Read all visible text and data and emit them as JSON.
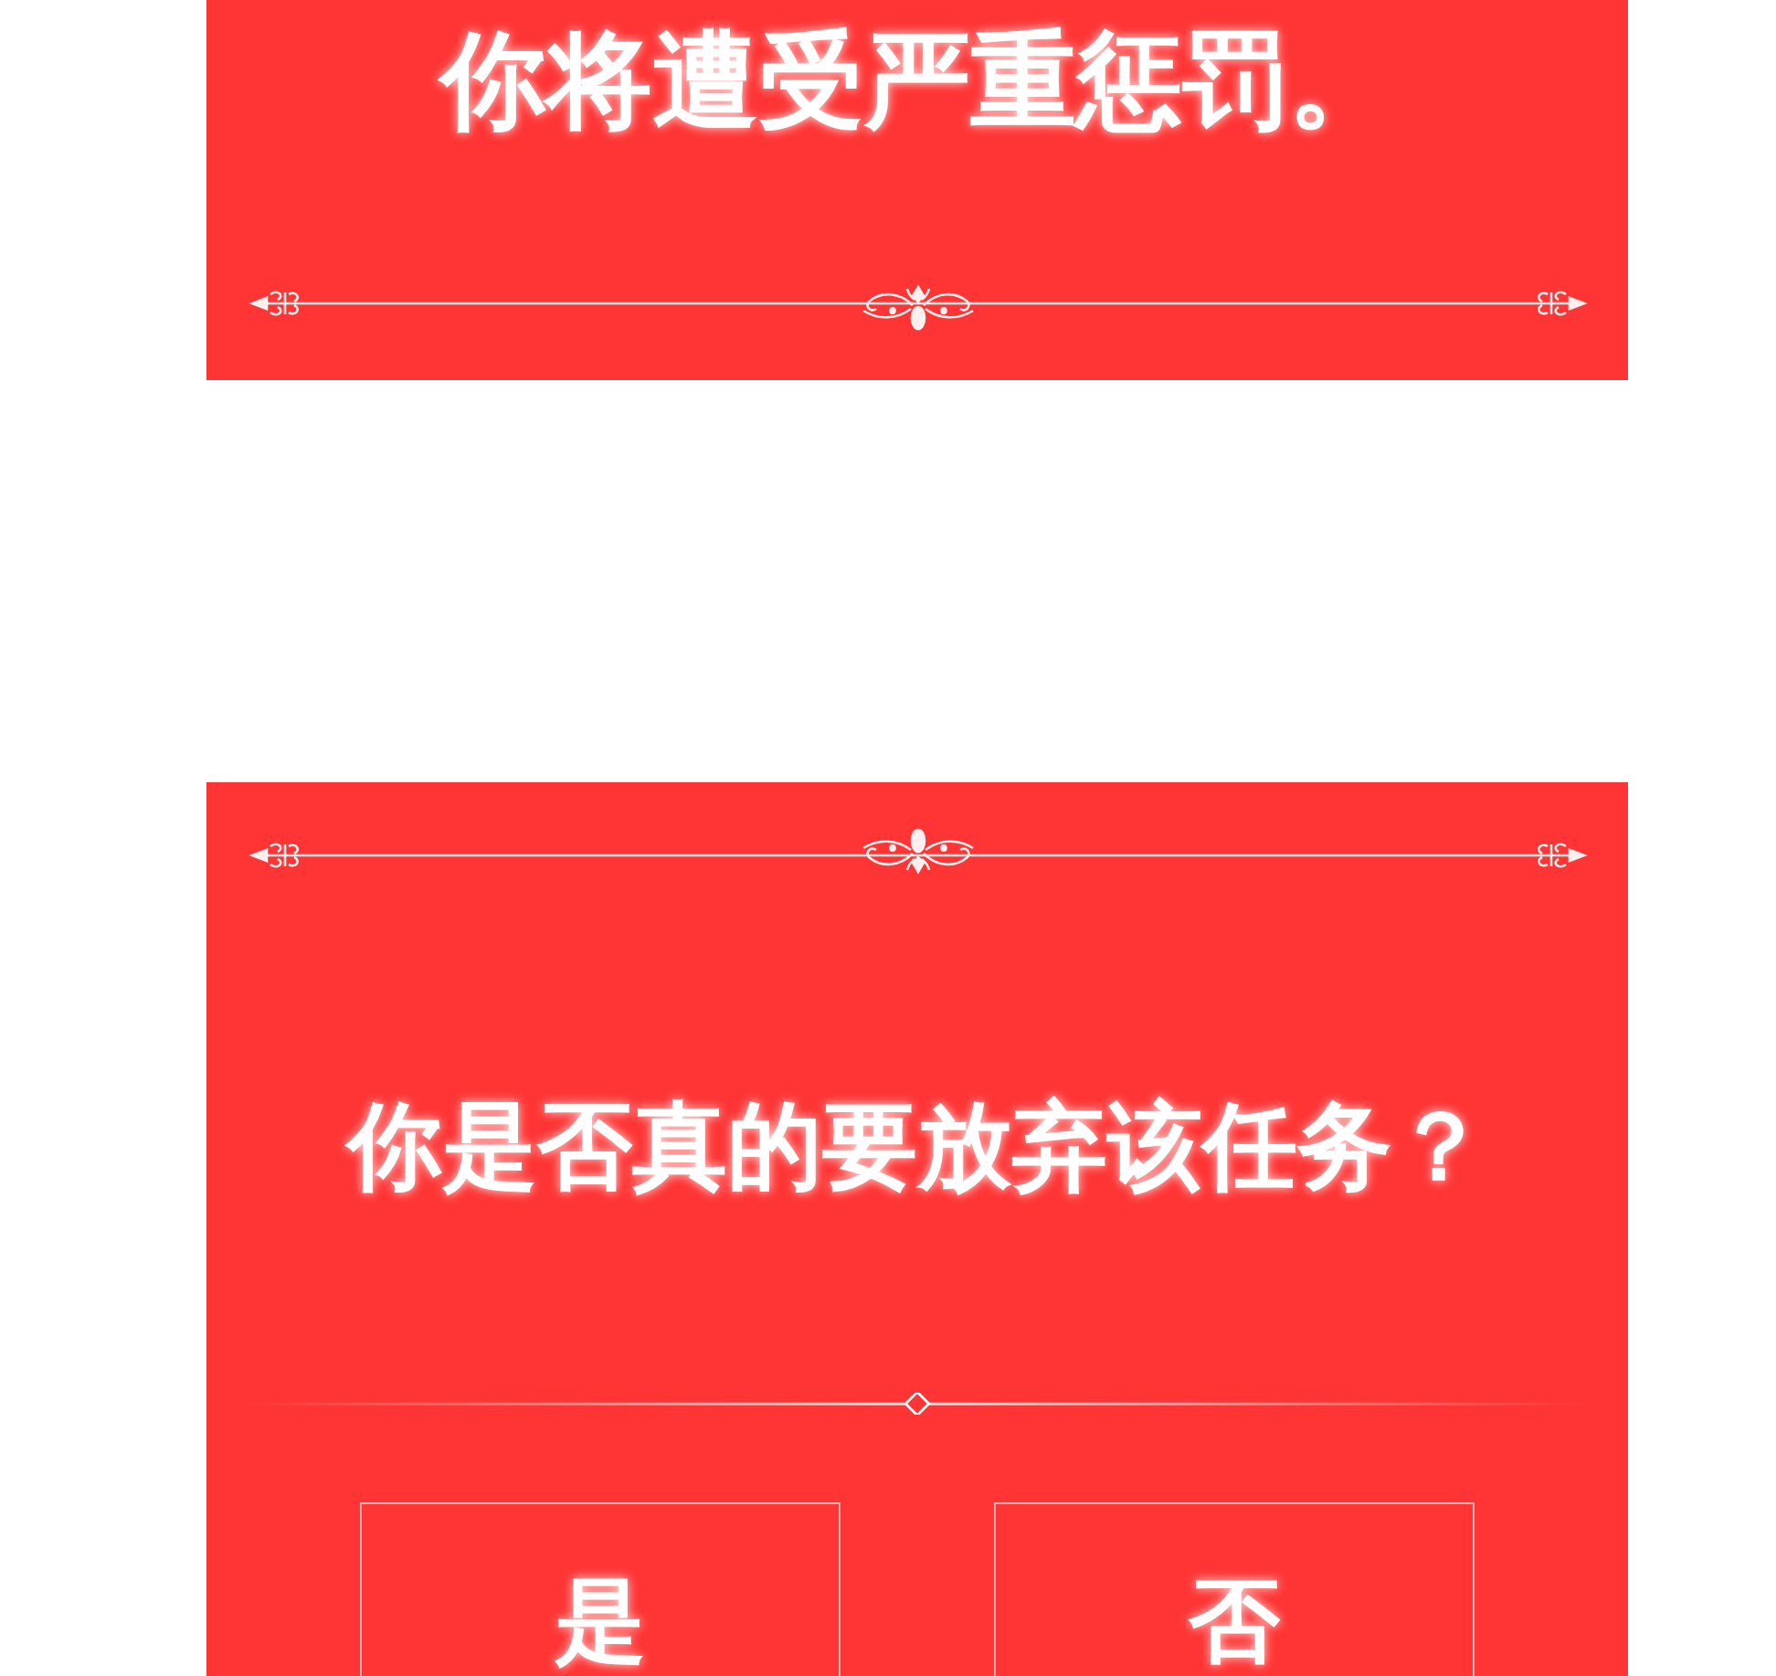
{
  "warning_card": {
    "message": "你将遭受严重惩罚。"
  },
  "confirm_dialog": {
    "question": "你是否真的要放弃该任务？",
    "buttons": [
      {
        "label": "是"
      },
      {
        "label": "否"
      }
    ]
  }
}
